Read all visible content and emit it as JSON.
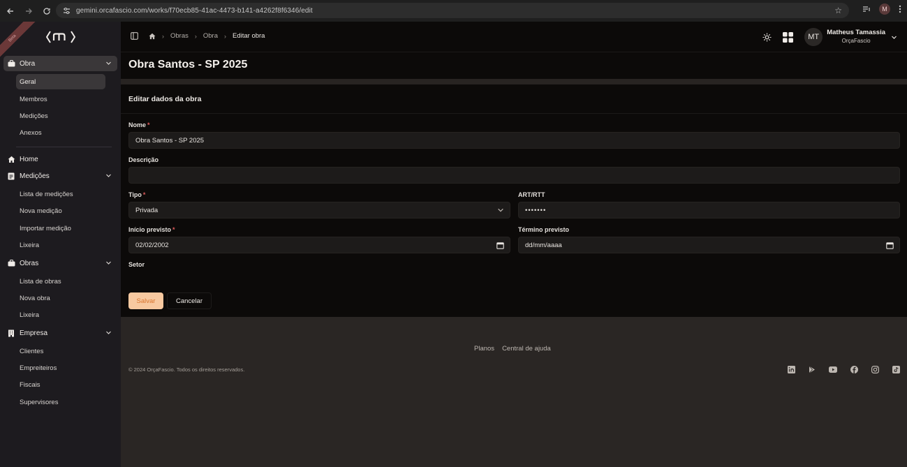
{
  "browser": {
    "url": "gemini.orcafascio.com/works/f70ecb85-41ac-4473-b141-a4262f8f6346/edit",
    "profile_initial": "M"
  },
  "sidebar": {
    "ribbon": "Beta",
    "obra_group": {
      "label": "Obra",
      "items": [
        "Geral",
        "Membros",
        "Medições",
        "Anexos"
      ]
    },
    "home_label": "Home",
    "medicoes_group": {
      "label": "Medições",
      "items": [
        "Lista de medições",
        "Nova medição",
        "Importar medição",
        "Lixeira"
      ]
    },
    "obras_group": {
      "label": "Obras",
      "items": [
        "Lista de obras",
        "Nova obra",
        "Lixeira"
      ]
    },
    "empresa_group": {
      "label": "Empresa",
      "items": [
        "Clientes",
        "Empreiteiros",
        "Fiscais",
        "Supervisores"
      ]
    }
  },
  "breadcrumb": {
    "items": [
      "Obras",
      "Obra"
    ],
    "current": "Editar obra"
  },
  "user": {
    "initials": "MT",
    "name": "Matheus Tamassia",
    "company": "OrçaFascio"
  },
  "page": {
    "title": "Obra Santos - SP 2025"
  },
  "form": {
    "card_title": "Editar dados da obra",
    "nome_label": "Nome",
    "nome_value": "Obra Santos - SP 2025",
    "descricao_label": "Descrição",
    "descricao_value": "",
    "tipo_label": "Tipo",
    "tipo_value": "Privada",
    "art_label": "ART/RTT",
    "art_value": "•••••••",
    "inicio_label": "Início previsto",
    "inicio_value": "02/02/2002",
    "termino_label": "Término previsto",
    "termino_value": "dd/mm/aaaa",
    "setor_label": "Setor",
    "required_mark": "*",
    "save_label": "Salvar",
    "cancel_label": "Cancelar"
  },
  "footer": {
    "links": [
      "Planos",
      "Central de ajuda"
    ],
    "copyright": "© 2024 OrçaFascio. Todos os direitos reservados.",
    "socials": [
      "linkedin-icon",
      "play-store-icon",
      "youtube-icon",
      "facebook-icon",
      "instagram-icon",
      "tiktok-icon"
    ]
  },
  "colors": {
    "accent": "#f8c9a0",
    "accent_text": "#d8752f",
    "required": "#e05c5c",
    "background": "#0c0a09",
    "sidebar": "#1d1b1f"
  }
}
